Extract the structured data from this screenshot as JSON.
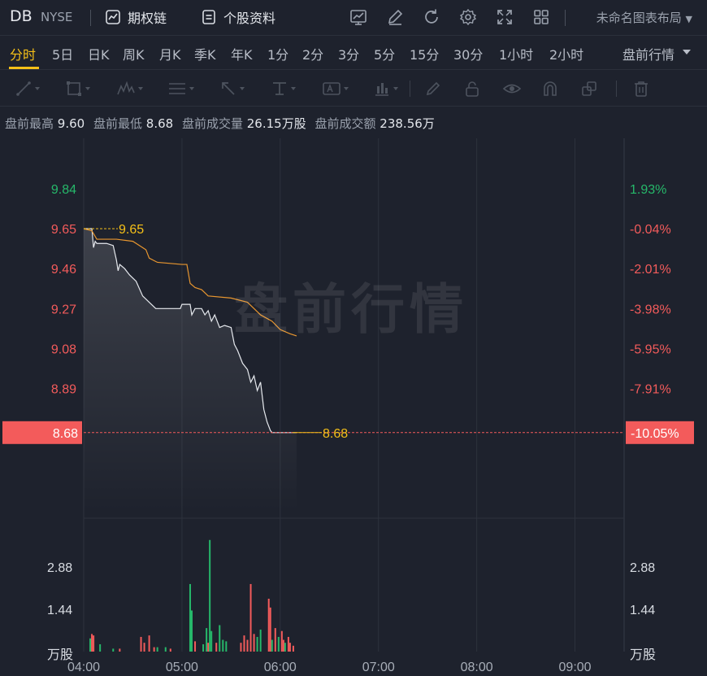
{
  "topbar": {
    "symbol": "DB",
    "exchange": "NYSE",
    "options_chain_label": "期权链",
    "stock_profile_label": "个股资料",
    "layout_label": "未命名图表布局"
  },
  "periods": {
    "items": [
      "分时",
      "5日",
      "日K",
      "周K",
      "月K",
      "季K",
      "年K",
      "1分",
      "2分",
      "3分",
      "5分",
      "15分",
      "30分",
      "1小时",
      "2小时"
    ],
    "active": "分时",
    "mode_label": "盘前行情"
  },
  "drawing_tools": [
    "trend-line",
    "rectangle",
    "wave-pattern",
    "parallel-channel",
    "arrow",
    "price-level",
    "text-note",
    "measure",
    "brush",
    "lock",
    "eye",
    "magnet",
    "layers",
    "delete"
  ],
  "summary": {
    "high_label": "盘前最高",
    "high_value": "9.60",
    "low_label": "盘前最低",
    "low_value": "8.68",
    "volume_label": "盘前成交量",
    "volume_value": "26.15万股",
    "amount_label": "盘前成交额",
    "amount_value": "238.56万"
  },
  "watermark": "盘前行情",
  "colors": {
    "up": "#26b86a",
    "down": "#f35b5b",
    "price_line": "#e6e9ee",
    "avg_line": "#e8962f",
    "highlight": "#f5c018",
    "background": "#1e222d"
  },
  "chart_data": {
    "type": "line",
    "y_ticks": [
      "9.84",
      "9.65",
      "9.46",
      "9.27",
      "9.08",
      "8.89",
      "8.68"
    ],
    "pct_ticks": [
      "1.93%",
      "-0.04%",
      "-2.01%",
      "-3.98%",
      "-5.95%",
      "-7.91%",
      "-10.05%"
    ],
    "ylim": [
      8.3,
      10.08
    ],
    "x_ticks": [
      "04:00",
      "05:00",
      "06:00",
      "07:00",
      "08:00",
      "09:00"
    ],
    "x_range": [
      "04:00",
      "09:30"
    ],
    "open_price_label": "9.65",
    "last_price_label": "8.68",
    "last_pct_label": "-10.05%",
    "volume_ticks": [
      "2.88",
      "1.44"
    ],
    "volume_unit": "万股",
    "volume_ylim": [
      0,
      4.32
    ],
    "price_series": {
      "name": "price",
      "points": [
        [
          "04:00",
          9.65
        ],
        [
          "04:05",
          9.65
        ],
        [
          "04:06",
          9.56
        ],
        [
          "04:07",
          9.59
        ],
        [
          "04:08",
          9.58
        ],
        [
          "04:10",
          9.58
        ],
        [
          "04:14",
          9.58
        ],
        [
          "04:18",
          9.57
        ],
        [
          "04:20",
          9.5
        ],
        [
          "04:21",
          9.45
        ],
        [
          "04:22",
          9.48
        ],
        [
          "04:25",
          9.46
        ],
        [
          "04:28",
          9.43
        ],
        [
          "04:32",
          9.4
        ],
        [
          "04:36",
          9.33
        ],
        [
          "04:40",
          9.3
        ],
        [
          "04:44",
          9.27
        ],
        [
          "04:50",
          9.27
        ],
        [
          "04:56",
          9.27
        ],
        [
          "04:59",
          9.27
        ],
        [
          "05:00",
          9.29
        ],
        [
          "05:05",
          9.29
        ],
        [
          "05:06",
          9.24
        ],
        [
          "05:08",
          9.27
        ],
        [
          "05:12",
          9.27
        ],
        [
          "05:14",
          9.24
        ],
        [
          "05:16",
          9.26
        ],
        [
          "05:18",
          9.21
        ],
        [
          "05:20",
          9.24
        ],
        [
          "05:23",
          9.18
        ],
        [
          "05:26",
          9.19
        ],
        [
          "05:30",
          9.18
        ],
        [
          "05:32",
          9.1
        ],
        [
          "05:34",
          9.07
        ],
        [
          "05:37",
          9.01
        ],
        [
          "05:40",
          8.98
        ],
        [
          "05:42",
          8.92
        ],
        [
          "05:44",
          8.95
        ],
        [
          "05:46",
          8.88
        ],
        [
          "05:48",
          8.92
        ],
        [
          "05:50",
          8.79
        ],
        [
          "05:52",
          8.73
        ],
        [
          "05:54",
          8.69
        ],
        [
          "05:55",
          8.68
        ],
        [
          "06:10",
          8.68
        ]
      ]
    },
    "avg_series": {
      "name": "avg",
      "points": [
        [
          "04:00",
          9.65
        ],
        [
          "04:05",
          9.64
        ],
        [
          "04:08",
          9.6
        ],
        [
          "04:20",
          9.6
        ],
        [
          "04:30",
          9.59
        ],
        [
          "04:38",
          9.55
        ],
        [
          "04:40",
          9.51
        ],
        [
          "04:45",
          9.49
        ],
        [
          "05:00",
          9.48
        ],
        [
          "05:03",
          9.48
        ],
        [
          "05:05",
          9.39
        ],
        [
          "05:08",
          9.37
        ],
        [
          "05:12",
          9.36
        ],
        [
          "05:16",
          9.33
        ],
        [
          "05:30",
          9.32
        ],
        [
          "05:40",
          9.3
        ],
        [
          "05:48",
          9.24
        ],
        [
          "05:55",
          9.21
        ],
        [
          "06:00",
          9.17
        ],
        [
          "06:06",
          9.15
        ],
        [
          "06:10",
          9.14
        ]
      ]
    },
    "volume": [
      {
        "t": "04:04",
        "v": 0.45,
        "dir": "up"
      },
      {
        "t": "04:05",
        "v": 0.6,
        "dir": "down"
      },
      {
        "t": "04:06",
        "v": 0.55,
        "dir": "down"
      },
      {
        "t": "04:10",
        "v": 0.25,
        "dir": "up"
      },
      {
        "t": "04:18",
        "v": 0.1,
        "dir": "up"
      },
      {
        "t": "04:22",
        "v": 0.1,
        "dir": "down"
      },
      {
        "t": "04:35",
        "v": 0.5,
        "dir": "down"
      },
      {
        "t": "04:37",
        "v": 0.3,
        "dir": "down"
      },
      {
        "t": "04:40",
        "v": 0.55,
        "dir": "down"
      },
      {
        "t": "04:43",
        "v": 0.15,
        "dir": "down"
      },
      {
        "t": "04:45",
        "v": 0.15,
        "dir": "up"
      },
      {
        "t": "04:50",
        "v": 0.15,
        "dir": "up"
      },
      {
        "t": "04:53",
        "v": 0.1,
        "dir": "down"
      },
      {
        "t": "05:05",
        "v": 2.3,
        "dir": "up"
      },
      {
        "t": "05:06",
        "v": 1.4,
        "dir": "up"
      },
      {
        "t": "05:08",
        "v": 0.35,
        "dir": "down"
      },
      {
        "t": "05:13",
        "v": 0.25,
        "dir": "up"
      },
      {
        "t": "05:15",
        "v": 0.8,
        "dir": "up"
      },
      {
        "t": "05:16",
        "v": 0.3,
        "dir": "down"
      },
      {
        "t": "05:17",
        "v": 3.8,
        "dir": "up"
      },
      {
        "t": "05:18",
        "v": 0.7,
        "dir": "up"
      },
      {
        "t": "05:21",
        "v": 0.3,
        "dir": "down"
      },
      {
        "t": "05:23",
        "v": 0.9,
        "dir": "up"
      },
      {
        "t": "05:25",
        "v": 0.4,
        "dir": "up"
      },
      {
        "t": "05:27",
        "v": 0.35,
        "dir": "up"
      },
      {
        "t": "05:36",
        "v": 0.3,
        "dir": "down"
      },
      {
        "t": "05:38",
        "v": 0.55,
        "dir": "down"
      },
      {
        "t": "05:40",
        "v": 0.4,
        "dir": "down"
      },
      {
        "t": "05:42",
        "v": 2.3,
        "dir": "down"
      },
      {
        "t": "05:44",
        "v": 0.6,
        "dir": "down"
      },
      {
        "t": "05:46",
        "v": 0.5,
        "dir": "up"
      },
      {
        "t": "05:48",
        "v": 0.75,
        "dir": "up"
      },
      {
        "t": "05:53",
        "v": 1.8,
        "dir": "down"
      },
      {
        "t": "05:54",
        "v": 1.5,
        "dir": "down"
      },
      {
        "t": "05:55",
        "v": 0.4,
        "dir": "up"
      },
      {
        "t": "05:57",
        "v": 0.8,
        "dir": "down"
      },
      {
        "t": "05:59",
        "v": 0.5,
        "dir": "up"
      },
      {
        "t": "06:01",
        "v": 0.7,
        "dir": "down"
      },
      {
        "t": "06:02",
        "v": 0.4,
        "dir": "down"
      },
      {
        "t": "06:03",
        "v": 0.3,
        "dir": "up"
      },
      {
        "t": "06:05",
        "v": 0.5,
        "dir": "down"
      },
      {
        "t": "06:06",
        "v": 0.3,
        "dir": "down"
      },
      {
        "t": "06:08",
        "v": 0.2,
        "dir": "down"
      }
    ]
  }
}
